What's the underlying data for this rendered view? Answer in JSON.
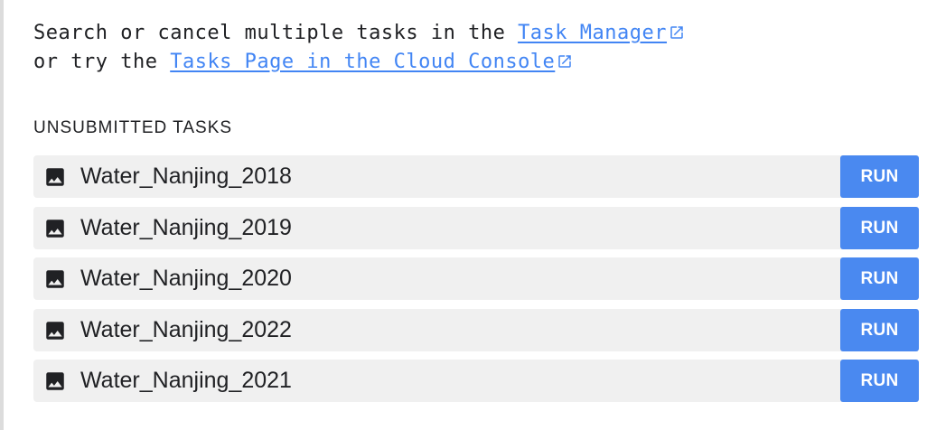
{
  "intro": {
    "line1_prefix": "Search or cancel multiple tasks in the ",
    "task_manager_link": "Task Manager",
    "line2_prefix": "or try the ",
    "cloud_console_link": "Tasks Page in the Cloud Console",
    "external_link_icon": "open-in-new-icon"
  },
  "section": {
    "title": "UNSUBMITTED TASKS"
  },
  "tasks": [
    {
      "name": "Water_Nanjing_2018",
      "icon": "image-icon",
      "button_label": "RUN"
    },
    {
      "name": "Water_Nanjing_2019",
      "icon": "image-icon",
      "button_label": "RUN"
    },
    {
      "name": "Water_Nanjing_2020",
      "icon": "image-icon",
      "button_label": "RUN"
    },
    {
      "name": "Water_Nanjing_2022",
      "icon": "image-icon",
      "button_label": "RUN"
    },
    {
      "name": "Water_Nanjing_2021",
      "icon": "image-icon",
      "button_label": "RUN"
    }
  ],
  "colors": {
    "link": "#4285f4",
    "run_button": "#4a89f0",
    "row_background": "#f0f0f0",
    "text": "#202124"
  }
}
